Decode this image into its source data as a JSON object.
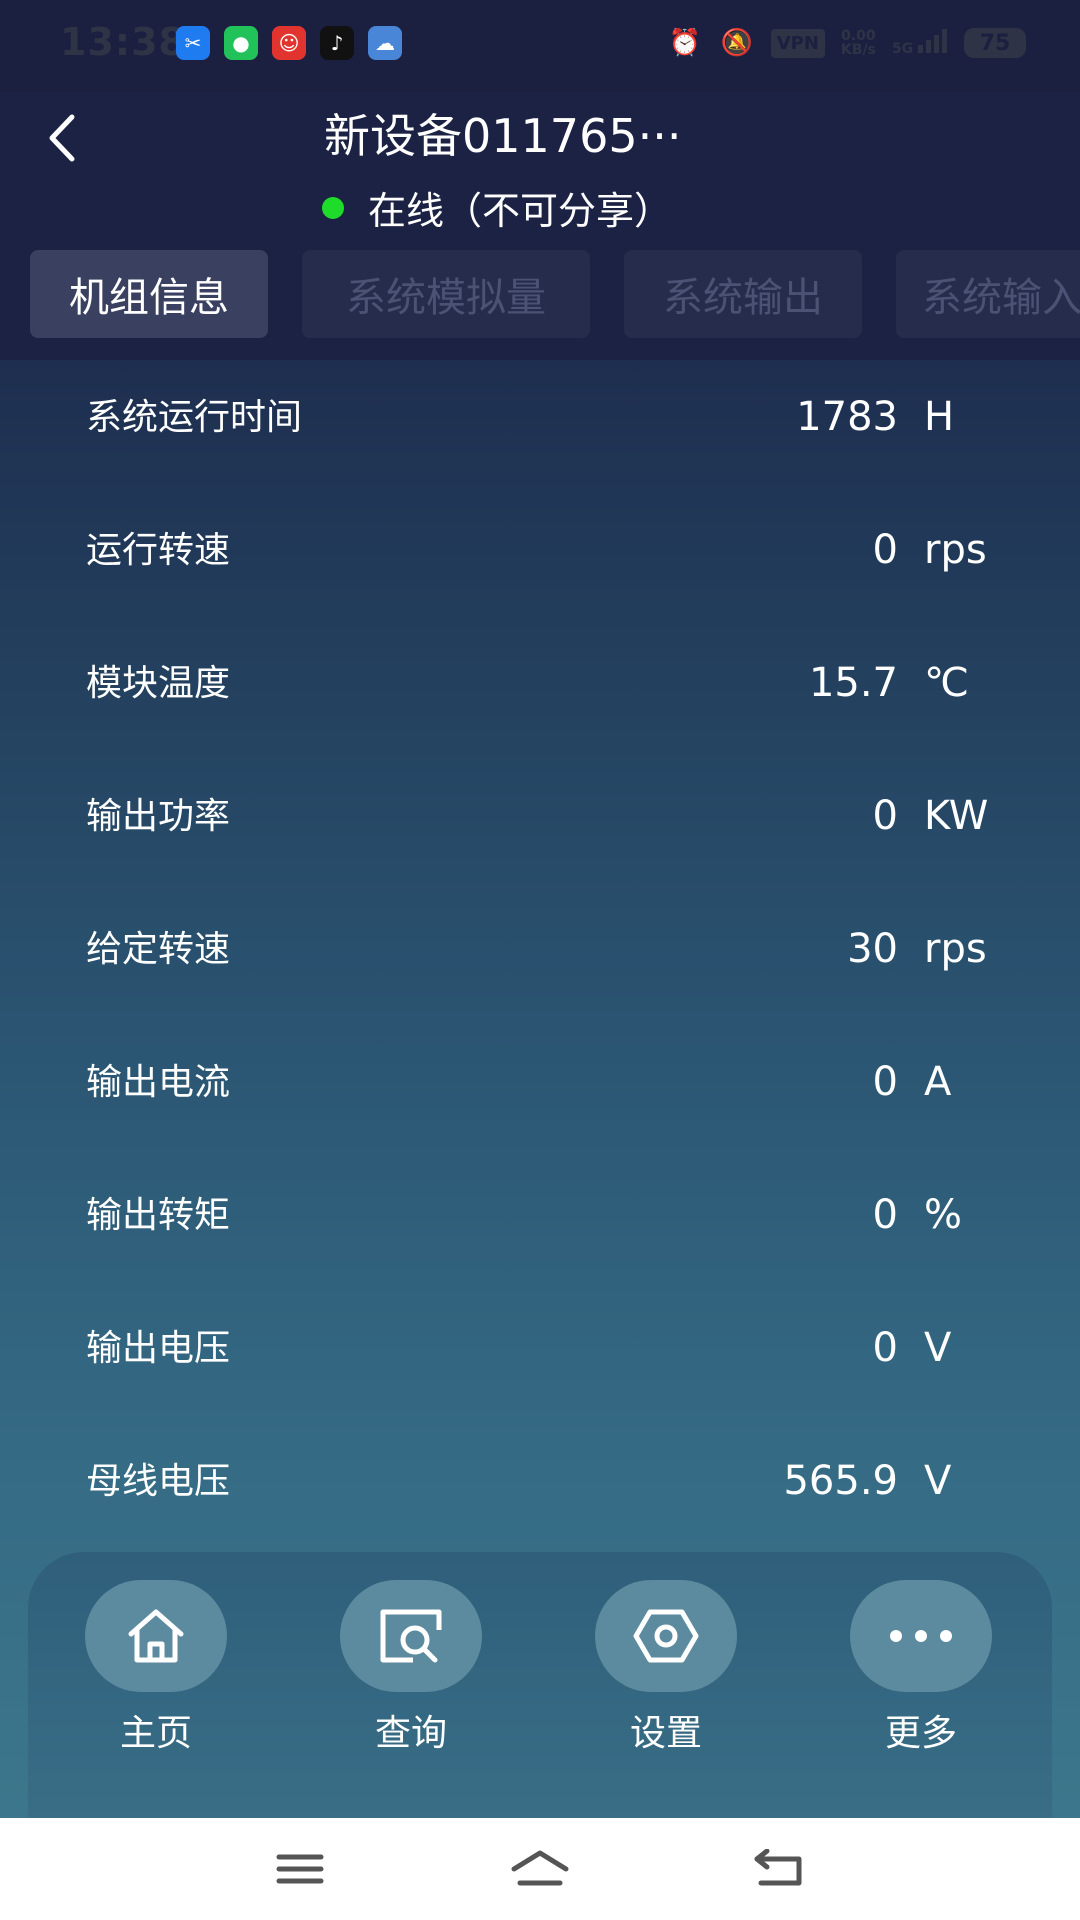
{
  "status_bar": {
    "time": "13:38",
    "vpn": "VPN",
    "net_speed_value": "0.00",
    "net_speed_unit": "KB/s",
    "network": "5G",
    "battery": "75"
  },
  "header": {
    "title": "新设备011765···",
    "status": "在线（不可分享）",
    "status_color": "#1edc2a"
  },
  "tabs": [
    {
      "label": "机组信息",
      "active": true
    },
    {
      "label": "系统模拟量",
      "active": false
    },
    {
      "label": "系统输出",
      "active": false
    },
    {
      "label": "系统输入",
      "active": false
    }
  ],
  "rows": [
    {
      "label": "系统运行时间",
      "value": "1783",
      "unit": "H"
    },
    {
      "label": "运行转速",
      "value": "0",
      "unit": "rps"
    },
    {
      "label": "模块温度",
      "value": "15.7",
      "unit": "℃"
    },
    {
      "label": "输出功率",
      "value": "0",
      "unit": "KW"
    },
    {
      "label": "给定转速",
      "value": "30",
      "unit": "rps"
    },
    {
      "label": "输出电流",
      "value": "0",
      "unit": "A"
    },
    {
      "label": "输出转矩",
      "value": "0",
      "unit": "%"
    },
    {
      "label": "输出电压",
      "value": "0",
      "unit": "V"
    },
    {
      "label": "母线电压",
      "value": "565.9",
      "unit": "V"
    }
  ],
  "bottom_nav": [
    {
      "label": "主页",
      "icon": "home-icon"
    },
    {
      "label": "查询",
      "icon": "search-icon"
    },
    {
      "label": "设置",
      "icon": "settings-icon"
    },
    {
      "label": "更多",
      "icon": "more-icon"
    }
  ]
}
